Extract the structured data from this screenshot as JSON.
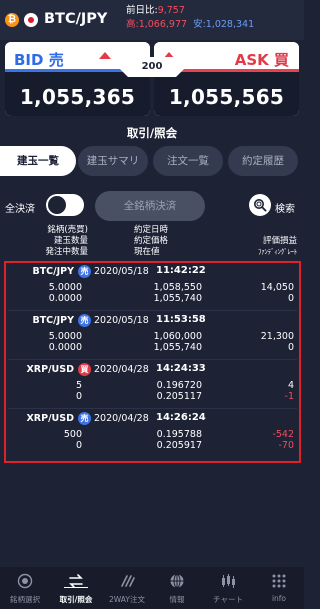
{
  "header": {
    "coin_icon": "bitcoin-icon",
    "flag_icon": "japan-flag-icon",
    "pair": "BTC/JPY",
    "change_label": "前日比:",
    "change_value": "9,757",
    "high_label": "高:",
    "high_value": "1,066,977",
    "low_label": "安:",
    "low_value": "1,028,341"
  },
  "quote": {
    "bid_label": "BID 売",
    "bid_price": "1,055,365",
    "ask_label": "ASK 買",
    "ask_price": "1,055,565",
    "spread": "200"
  },
  "section_title": "取引/照会",
  "tabs": [
    {
      "label": "建玉一覧",
      "active": true
    },
    {
      "label": "建玉サマリ",
      "active": false
    },
    {
      "label": "注文一覧",
      "active": false
    },
    {
      "label": "約定履歴",
      "active": false
    }
  ],
  "controls": {
    "close_all_label": "全決済",
    "bulk_button": "全銘柄決済",
    "search_label": "検索"
  },
  "columns": {
    "c1": [
      "銘柄(売買)",
      "建玉数量",
      "発注中数量"
    ],
    "c2": [
      "約定日時",
      "約定価格",
      "現在値"
    ],
    "c3": [
      "評価損益",
      "ﾌｧﾝﾃﾞｨﾝｸﾞﾚｰﾄ"
    ]
  },
  "positions": [
    {
      "symbol": "BTC/JPY",
      "side": "売",
      "side_type": "sell",
      "qty": "5.0000",
      "pending_qty": "0.0000",
      "date": "2020/05/18",
      "time": "11:42:22",
      "price": "1,058,550",
      "current": "1,055,740",
      "pl": "14,050",
      "funding": "0"
    },
    {
      "symbol": "BTC/JPY",
      "side": "売",
      "side_type": "sell",
      "qty": "5.0000",
      "pending_qty": "0.0000",
      "date": "2020/05/18",
      "time": "11:53:58",
      "price": "1,060,000",
      "current": "1,055,740",
      "pl": "21,300",
      "funding": "0"
    },
    {
      "symbol": "XRP/USD",
      "side": "買",
      "side_type": "buy",
      "qty": "5",
      "pending_qty": "0",
      "date": "2020/04/28",
      "time": "14:24:33",
      "price": "0.196720",
      "current": "0.205117",
      "pl": "4",
      "funding": "-1"
    },
    {
      "symbol": "XRP/USD",
      "side": "売",
      "side_type": "sell",
      "qty": "500",
      "pending_qty": "0",
      "date": "2020/04/28",
      "time": "14:26:24",
      "price": "0.195788",
      "current": "0.205917",
      "pl": "-542",
      "funding": "-70"
    }
  ],
  "nav": [
    {
      "label": "銘柄選択",
      "icon": "symbol-select-icon",
      "active": false
    },
    {
      "label": "取引/照会",
      "icon": "trade-icon",
      "active": true
    },
    {
      "label": "2WAY注文",
      "icon": "two-way-order-icon",
      "active": false
    },
    {
      "label": "情報",
      "icon": "info-globe-icon",
      "active": false
    },
    {
      "label": "チャート",
      "icon": "chart-icon",
      "active": false
    },
    {
      "label": "info",
      "icon": "grid-menu-icon",
      "active": false
    }
  ],
  "colors": {
    "background": "#1d2235",
    "bid": "#2f6be6",
    "ask": "#e23a48",
    "highlight_border": "#e0202a",
    "negative": "#f24d5b"
  }
}
